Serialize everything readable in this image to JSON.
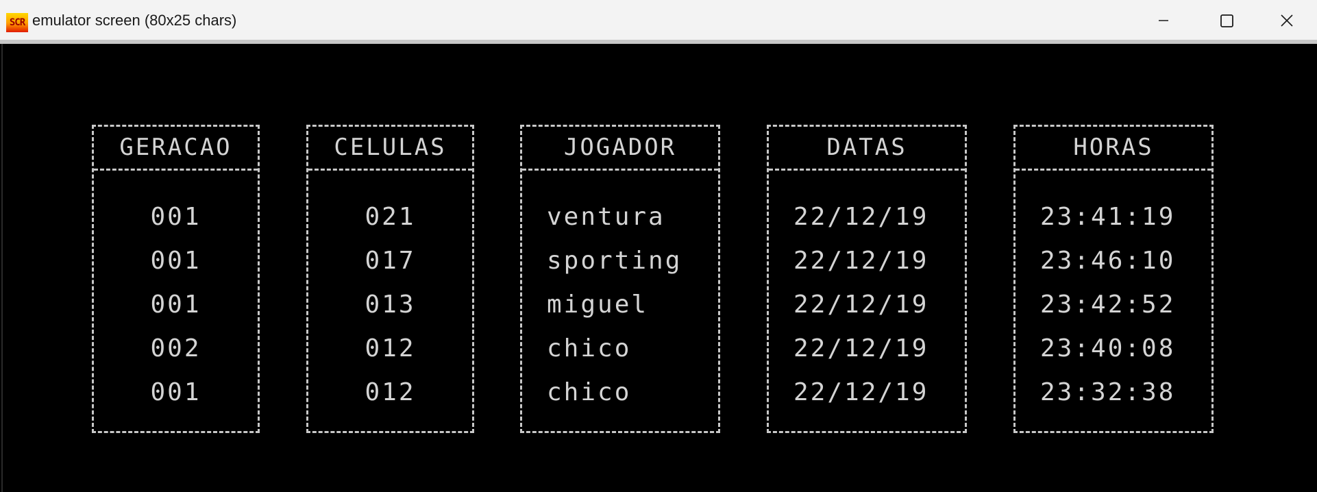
{
  "window": {
    "title": "emulator screen (80x25 chars)",
    "app_icon_text": "SCR",
    "controls": {
      "minimize": "minimize-icon",
      "maximize": "maximize-icon",
      "close": "close-icon"
    }
  },
  "colors": {
    "screen_bg": "#000000",
    "text": "#d4d4d4",
    "border": "#c8c8c8",
    "titlebar_bg": "#f3f3f3"
  },
  "table": {
    "columns": [
      {
        "header": "GERACAO",
        "values": [
          "001",
          "001",
          "001",
          "002",
          "001"
        ]
      },
      {
        "header": "CELULAS",
        "values": [
          "021",
          "017",
          "013",
          "012",
          "012"
        ]
      },
      {
        "header": "JOGADOR",
        "values": [
          "ventura",
          "sporting",
          "miguel",
          "chico",
          "chico"
        ]
      },
      {
        "header": "DATAS",
        "values": [
          "22/12/19",
          "22/12/19",
          "22/12/19",
          "22/12/19",
          "22/12/19"
        ]
      },
      {
        "header": "HORAS",
        "values": [
          "23:41:19",
          "23:46:10",
          "23:42:52",
          "23:40:08",
          "23:32:38"
        ]
      }
    ]
  }
}
